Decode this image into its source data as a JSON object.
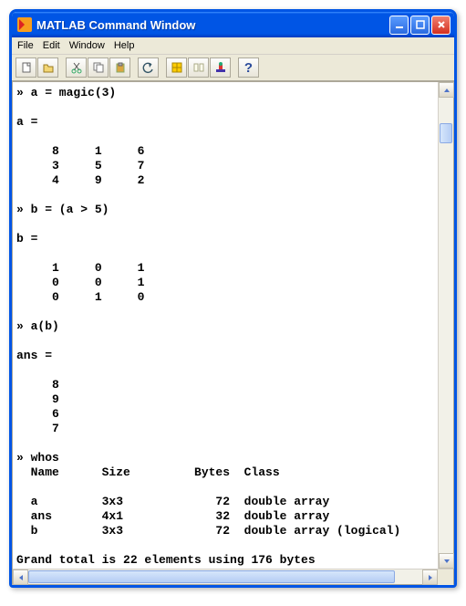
{
  "titlebar": {
    "title": "MATLAB Command Window"
  },
  "menubar": {
    "file": "File",
    "edit": "Edit",
    "window": "Window",
    "help": "Help"
  },
  "toolbar": {
    "new": "new",
    "open": "open",
    "cut": "cut",
    "copy": "copy",
    "paste": "paste",
    "undo": "undo",
    "workspace": "workspace",
    "path": "path",
    "simulink": "simulink",
    "help": "?"
  },
  "console": {
    "text": "» a = magic(3)\n\na =\n\n     8     1     6\n     3     5     7\n     4     9     2\n\n» b = (a > 5)\n\nb =\n\n     1     0     1\n     0     0     1\n     0     1     0\n\n» a(b)\n\nans =\n\n     8\n     9\n     6\n     7\n\n» whos\n  Name      Size         Bytes  Class\n\n  a         3x3             72  double array\n  ans       4x1             32  double array\n  b         3x3             72  double array (logical)\n\nGrand total is 22 elements using 176 bytes\n\n»"
  },
  "chart_data": {
    "type": "table",
    "title": "whos",
    "columns": [
      "Name",
      "Size",
      "Bytes",
      "Class"
    ],
    "rows": [
      [
        "a",
        "3x3",
        72,
        "double array"
      ],
      [
        "ans",
        "4x1",
        32,
        "double array"
      ],
      [
        "b",
        "3x3",
        72,
        "double array (logical)"
      ]
    ],
    "footer": "Grand total is 22 elements using 176 bytes",
    "matrices": {
      "a": [
        [
          8,
          1,
          6
        ],
        [
          3,
          5,
          7
        ],
        [
          4,
          9,
          2
        ]
      ],
      "b": [
        [
          1,
          0,
          1
        ],
        [
          0,
          0,
          1
        ],
        [
          0,
          1,
          0
        ]
      ],
      "ans": [
        8,
        9,
        6,
        7
      ]
    }
  }
}
